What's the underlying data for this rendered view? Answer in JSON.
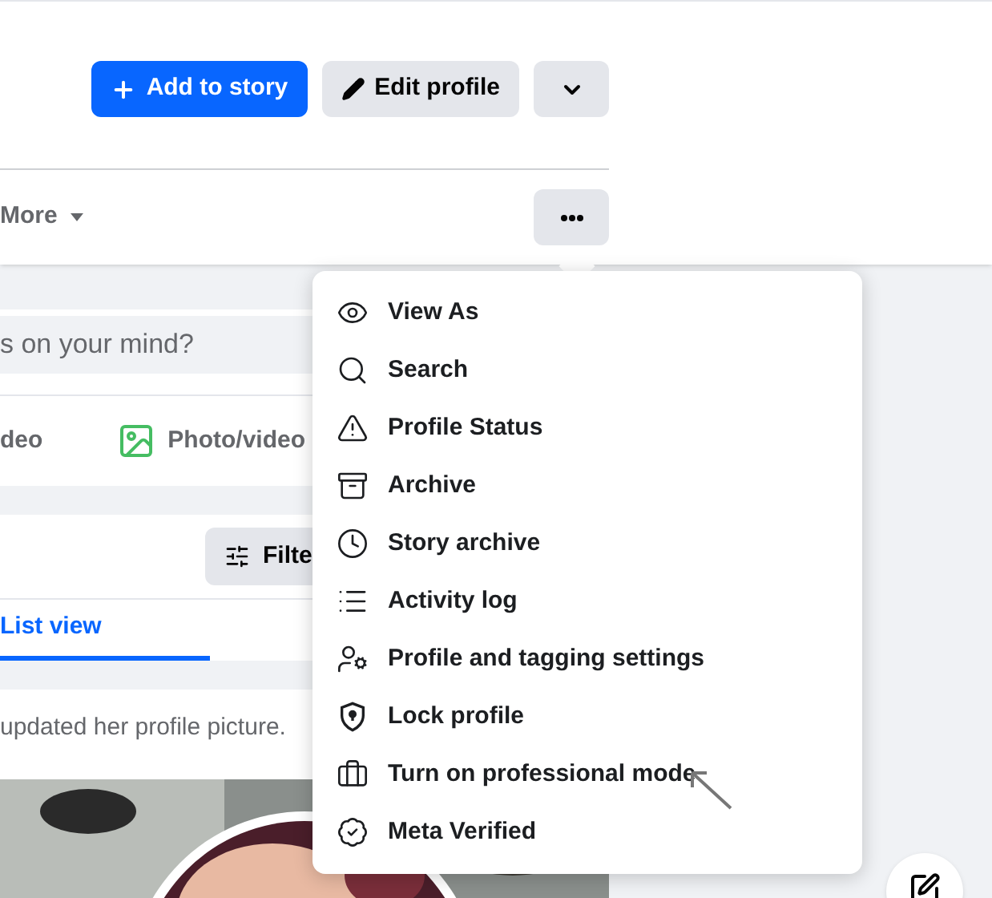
{
  "header": {
    "buttons": [
      {
        "label": "Add to story",
        "kind": "primary"
      },
      {
        "label": "Edit profile",
        "kind": "secondary"
      }
    ],
    "more_tab": "More"
  },
  "composer": {
    "placeholder": "s on your mind?",
    "actions": [
      "deo",
      "Photo/video"
    ]
  },
  "filters": {
    "button": "Filte",
    "tabs": [
      {
        "label": "List view",
        "selected": true
      }
    ]
  },
  "post": {
    "text": "updated her profile picture."
  },
  "menu": {
    "items": [
      "View As",
      "Search",
      "Profile Status",
      "Archive",
      "Story archive",
      "Activity log",
      "Profile and tagging settings",
      "Lock profile",
      "Turn on professional mode",
      "Meta Verified"
    ]
  }
}
